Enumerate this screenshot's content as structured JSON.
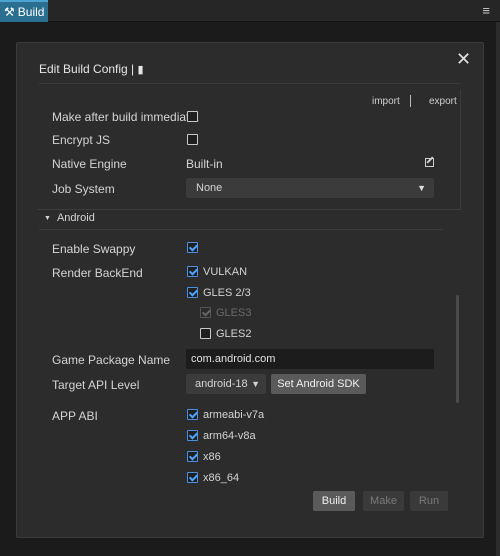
{
  "app": {
    "tab_title": "Build",
    "menu_icon": "hamburger-icon"
  },
  "dialog": {
    "title": "Edit Build Config |",
    "book_icon": "book-icon",
    "close_icon": "close-icon",
    "import_label": "import",
    "export_label": "export"
  },
  "general": {
    "make_after_build": {
      "label": "Make after build immediat...",
      "checked": false
    },
    "encrypt_js": {
      "label": "Encrypt JS",
      "checked": false
    },
    "native_engine": {
      "label": "Native Engine",
      "value": "Built-in",
      "edit_icon": "edit-icon"
    },
    "job_system": {
      "label": "Job System",
      "value": "None"
    }
  },
  "android": {
    "section_label": "Android",
    "enable_swappy": {
      "label": "Enable Swappy",
      "checked": true
    },
    "render_backend": {
      "label": "Render BackEnd",
      "vulkan": {
        "label": "VULKAN",
        "checked": true
      },
      "gles23": {
        "label": "GLES 2/3",
        "checked": true
      },
      "gles3": {
        "label": "GLES3",
        "checked": true,
        "disabled": true
      },
      "gles2": {
        "label": "GLES2",
        "checked": false
      }
    },
    "game_package_name": {
      "label": "Game Package Name",
      "value": "com.android.com"
    },
    "target_api_level": {
      "label": "Target API Level",
      "value": "android-18",
      "set_sdk_label": "Set Android SDK"
    },
    "app_abi": {
      "label": "APP ABI",
      "options": [
        {
          "label": "armeabi-v7a",
          "checked": true
        },
        {
          "label": "arm64-v8a",
          "checked": true
        },
        {
          "label": "x86",
          "checked": true
        },
        {
          "label": "x86_64",
          "checked": true
        }
      ]
    }
  },
  "actions": {
    "build_label": "Build",
    "make_label": "Make",
    "run_label": "Run"
  },
  "colors": {
    "tab_active": "#2a6f8f",
    "checkbox_accent": "#4da3ff",
    "panel_bg": "#2c2c2c"
  }
}
